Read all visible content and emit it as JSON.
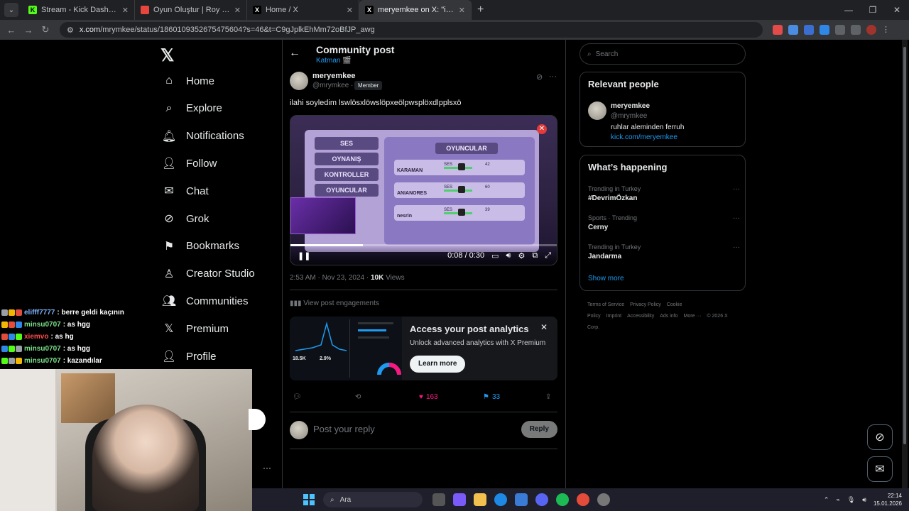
{
  "browser": {
    "tabs": [
      {
        "title": "Stream - Kick Dashboard",
        "fav_color": "#53fc18",
        "fav_text": "K",
        "active": false
      },
      {
        "title": "Oyun Oluştur | Roy G Biv",
        "fav_color": "#e8453c",
        "fav_text": "",
        "active": false
      },
      {
        "title": "Home / X",
        "fav_color": "#000000",
        "fav_text": "X",
        "active": false
      },
      {
        "title": "meryemkee on X: \"ilahi soy",
        "fav_color": "#000000",
        "fav_text": "X",
        "active": true
      }
    ],
    "url_host": "x.com",
    "url_path": "/mrymkee/status/1860109352675475604?s=46&t=C9gJplkEhMm72oBfJP_awg",
    "win_minimize": "—",
    "win_restore": "❐",
    "win_close": "✕"
  },
  "left_nav": {
    "logo": "𝕏",
    "items": [
      {
        "label": "Home",
        "icon": "home-icon",
        "glyph": "⌂"
      },
      {
        "label": "Explore",
        "icon": "search-icon",
        "glyph": "⌕"
      },
      {
        "label": "Notifications",
        "icon": "bell-icon",
        "glyph": "🔔︎"
      },
      {
        "label": "Follow",
        "icon": "follow-icon",
        "glyph": "👤︎"
      },
      {
        "label": "Chat",
        "icon": "mail-icon",
        "glyph": "✉"
      },
      {
        "label": "Grok",
        "icon": "grok-icon",
        "glyph": "⊘"
      },
      {
        "label": "Bookmarks",
        "icon": "bookmark-icon",
        "glyph": "⚑"
      },
      {
        "label": "Creator Studio",
        "icon": "creator-studio-icon",
        "glyph": "♙"
      },
      {
        "label": "Communities",
        "icon": "communities-icon",
        "glyph": "👥︎"
      },
      {
        "label": "Premium",
        "icon": "premium-x-icon",
        "glyph": "𝕏"
      },
      {
        "label": "Profile",
        "icon": "profile-icon",
        "glyph": "👤︎"
      }
    ]
  },
  "main": {
    "header_title": "Community post",
    "header_sub": "Katman 🎬",
    "post": {
      "name": "meryemkee",
      "handle": "@mrymkee ·",
      "badge": "Member",
      "text": "ilahi soyledim lswlösxlöwslöpxeölpwsplöxdlpplsxö",
      "video_time": "0:08 / 0:30",
      "video_progress": 0.27,
      "game": {
        "menu": [
          "SES",
          "OYNANIŞ",
          "KONTROLLER",
          "OYUNCULAR"
        ],
        "list_title": "OYUNCULAR",
        "rows": [
          {
            "name": "KARAMAN",
            "ses": "SES",
            "num": "42"
          },
          {
            "name": "ANIANORES",
            "ses": "SES",
            "num": "60"
          },
          {
            "name": "nesrin",
            "ses": "SES",
            "num": "39"
          }
        ]
      },
      "time": "2:53 AM · Nov 23, 2024 ·",
      "views_count": "10K",
      "views_label": "Views",
      "engagements": "View post engagements"
    },
    "analytics": {
      "title": "Access your post analytics",
      "subtitle": "Unlock advanced analytics with X Premium",
      "button": "Learn more",
      "stat1": "18.5K",
      "stat2": "2.9%"
    },
    "actions": {
      "likes": "163",
      "bookmarks": "33"
    },
    "reply_placeholder": "Post your reply",
    "reply_button": "Reply"
  },
  "right": {
    "search_placeholder": "Search",
    "relevant_title": "Relevant people",
    "person": {
      "name": "meryemkee",
      "handle": "@mrymkee",
      "bio": "ruhlar aleminden ferruh",
      "link": "kick.com/meryemkee"
    },
    "happening_title": "What’s happening",
    "trends": [
      {
        "category": "Trending in Turkey",
        "name": "#DevrimÖzkan"
      },
      {
        "category": "Sports · Trending",
        "name": "Cerny"
      },
      {
        "category": "Trending in Turkey",
        "name": "Jandarma"
      }
    ],
    "show_more": "Show more",
    "footer": [
      "Terms of Service",
      "Privacy Policy",
      "Cookie Policy",
      "Imprint",
      "Accessibility",
      "Ads info",
      "More ···",
      "© 2026 X Corp."
    ]
  },
  "chat": [
    {
      "user": "elifff7777",
      "user_color": "#7fb5ff",
      "msg": ": berre geldi kaçının"
    },
    {
      "user": "minsu0707",
      "user_color": "#7ee08a",
      "msg": ": as hgg"
    },
    {
      "user": "xiemvo",
      "user_color": "#ff4d4d",
      "msg": ": as hg"
    },
    {
      "user": "minsu0707",
      "user_color": "#7ee08a",
      "msg": ": as hgg"
    },
    {
      "user": "minsu0707",
      "user_color": "#7ee08a",
      "msg": ": kazandılar"
    }
  ],
  "taskbar": {
    "search_label": "Ara",
    "time": "22:14",
    "date": "15.01.2026"
  },
  "colors": {
    "accent": "#1d9bf0",
    "like": "#f91880",
    "background": "#000000"
  }
}
